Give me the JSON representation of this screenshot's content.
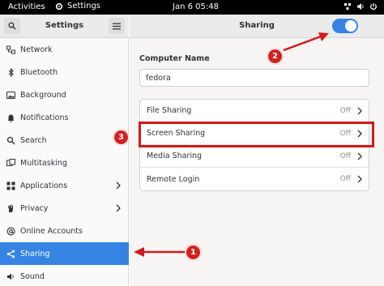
{
  "topbar": {
    "activities": "Activities",
    "app_name": "Settings",
    "clock": "Jan 6  05:48"
  },
  "sidebar": {
    "title": "Settings",
    "items": [
      {
        "label": "Network",
        "icon": "network-icon"
      },
      {
        "label": "Bluetooth",
        "icon": "bluetooth-icon"
      },
      {
        "label": "Background",
        "icon": "background-icon"
      },
      {
        "label": "Notifications",
        "icon": "bell-icon"
      },
      {
        "label": "Search",
        "icon": "search-icon"
      },
      {
        "label": "Multitasking",
        "icon": "multitasking-icon"
      },
      {
        "label": "Applications",
        "icon": "applications-icon"
      },
      {
        "label": "Privacy",
        "icon": "hand-icon"
      },
      {
        "label": "Online Accounts",
        "icon": "at-icon"
      },
      {
        "label": "Sharing",
        "icon": "share-icon"
      },
      {
        "label": "Sound",
        "icon": "speaker-icon"
      }
    ]
  },
  "main": {
    "title": "Sharing",
    "sharing_enabled": true,
    "computer_name_label": "Computer Name",
    "computer_name_value": "fedora",
    "rows": [
      {
        "label": "File Sharing",
        "status": "Off"
      },
      {
        "label": "Screen Sharing",
        "status": "Off"
      },
      {
        "label": "Media Sharing",
        "status": "Off"
      },
      {
        "label": "Remote Login",
        "status": "Off"
      }
    ]
  },
  "annotations": {
    "badge_1": "1",
    "badge_2": "2",
    "badge_3": "3"
  },
  "colors": {
    "accent": "#3584e4",
    "annotation_red": "#d11a1a",
    "topbar": "#000000"
  }
}
